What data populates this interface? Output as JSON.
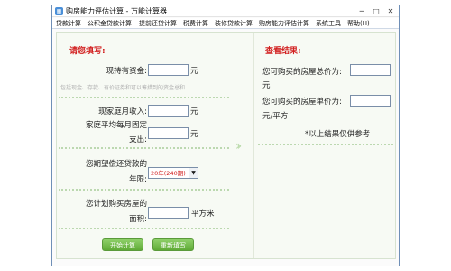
{
  "window": {
    "title": "购房能力评估计算 - 万能计算器",
    "icon": "calculator-icon",
    "controls": {
      "minimize": "─",
      "maximize": "□",
      "close": "✕"
    }
  },
  "menu": {
    "items": [
      "贷款计算",
      "公积金贷款计算",
      "提前还贷计算",
      "税费计算",
      "装修贷款计算",
      "购房能力评估计算",
      "系统工具",
      "帮助(H)"
    ]
  },
  "left": {
    "title": "请您填写:",
    "funds_label": "现持有资金:",
    "funds_unit": "元",
    "funds_hint": "包括现金、存款、有价证券和可以筹措到的资金总和",
    "income_label": "现家庭月收入:",
    "income_unit": "元",
    "expense_label_line1": "家庭平均每月固定",
    "expense_label_line2": "支出:",
    "expense_unit": "元",
    "years_label_line1": "您期望偿还贷款的",
    "years_label_line2": "年限:",
    "years_selected": "20年(240期)",
    "area_label_line1": "您计划购买房屋的",
    "area_label_line2": "面积:",
    "area_unit": "平方米",
    "calculate_button": "开始计算",
    "refill_button": "重新填写"
  },
  "right": {
    "title": "查看结果:",
    "total_label": "您可购买的房屋总价为:",
    "total_unit": "元",
    "unit_price_label": "您可购买的房屋单价为:",
    "unit_price_unit": "元/平方",
    "note": "*以上结果仅供参考"
  },
  "colors": {
    "accent_red": "#d22020",
    "button_green": "#5faa36",
    "divider_green": "#bcd8b0"
  }
}
